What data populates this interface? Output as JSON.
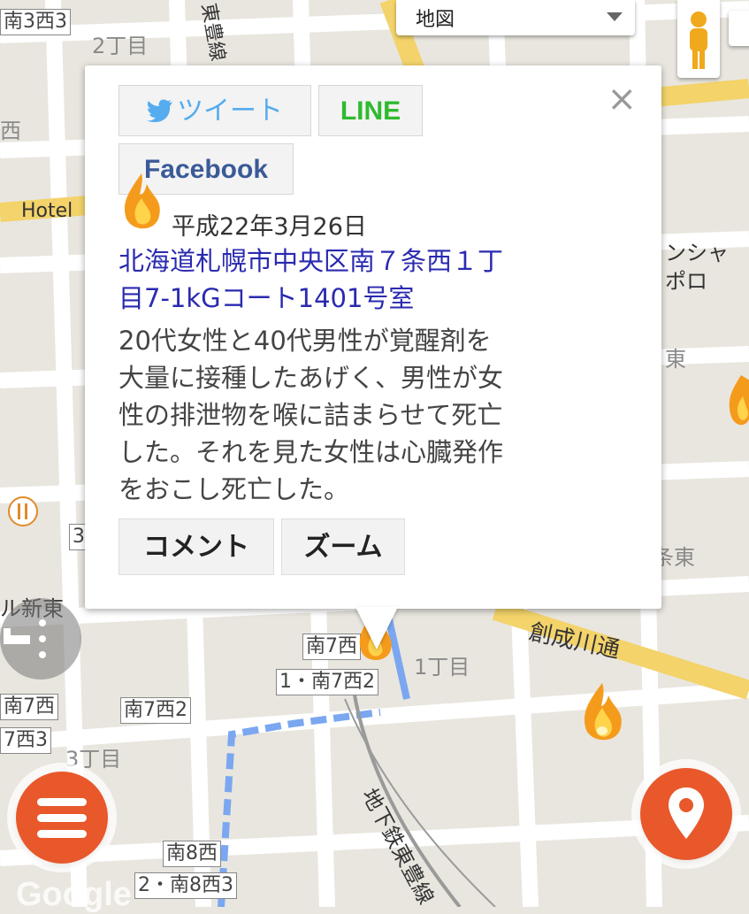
{
  "map": {
    "map_type_label": "地図",
    "road_labels": [
      "南3西3",
      "1・南7西2",
      "南7西2",
      "南7西",
      "7西3",
      "南8西",
      "2・南8西3",
      "南7西"
    ],
    "area_labels": [
      "2丁目",
      "1丁目",
      "3丁目",
      "西",
      "3",
      "Hotel",
      "ル新東",
      "ンシャ",
      "ポロ",
      "東",
      "条東"
    ],
    "street_labels": [
      "東豊線",
      "創成川通",
      "地下鉄東豊線"
    ],
    "attribution": "Google"
  },
  "info_window": {
    "tweet_label": "ツイート",
    "line_label": "LINE",
    "facebook_label": "Facebook",
    "close_label": "×",
    "date": "平成22年3月26日",
    "address_line1": "北海道札幌市中央区南７条西１丁",
    "address_line2": "目7-1kGコート1401号室",
    "desc_line1": "20代女性と40代男性が覚醒剤を",
    "desc_line2": "大量に接種したあげく、男性が女",
    "desc_line3": "性の排泄物を喉に詰まらせて死亡",
    "desc_line4": "した。それを見た女性は心臓発作",
    "desc_line5": "をおこし死亡した。",
    "comment_label": "コメント",
    "zoom_label": "ズーム"
  },
  "icons": {
    "marker": "flame-icon",
    "menu": "menu-icon",
    "location": "location-pin-icon",
    "hotel": "hotel-icon",
    "restaurant": "restaurant-icon",
    "pegman": "pegman-icon"
  },
  "colors": {
    "accent": "#e8582b",
    "twitter": "#55acee",
    "line": "#2fba2f",
    "facebook": "#3a5a98",
    "address_link": "#2a2ab0",
    "major_road": "#f3d36a",
    "transit_route": "#7aa7f0"
  }
}
